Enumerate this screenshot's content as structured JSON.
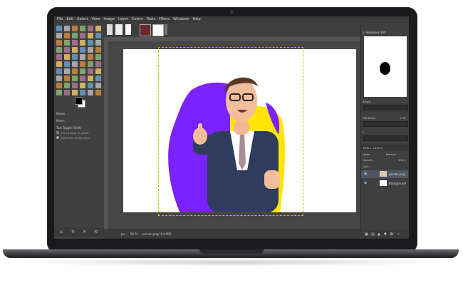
{
  "window": {
    "menu": [
      "File",
      "Edit",
      "Select",
      "View",
      "Image",
      "Layer",
      "Colors",
      "Tools",
      "Filters",
      "Windows",
      "Help"
    ]
  },
  "toolbox": {
    "tool_options_title": "Move",
    "mode_label": "Move:",
    "path_toggle_label": "Tool Toggle (Shift)",
    "option_pick": "Pick a layer or guide",
    "option_active": "Move the active layer"
  },
  "status": {
    "unit": "px",
    "zoom": "50 %",
    "file": "person.png (4.4 MB)"
  },
  "brushes": {
    "title": "2. Hardness 100",
    "shape_label": "Shape",
    "hardness_label": "Hardness",
    "hardness_value": "1.00",
    "spacing_label": "S"
  },
  "layers": {
    "tabs": [
      "Paths",
      "Layers"
    ],
    "mode_label": "Mode",
    "mode_value": "Normal",
    "opacity_label": "Opacity",
    "opacity_value": "100.0",
    "lock_label": "Lock:",
    "items": [
      {
        "name": "person.png"
      },
      {
        "name": "Background"
      }
    ]
  },
  "colors": {
    "purple": "#7a22ff",
    "yellow": "#ffe600",
    "suit": "#2f3c5c",
    "ui_dark": "#3f3f3f",
    "selection": "#c9b600"
  }
}
